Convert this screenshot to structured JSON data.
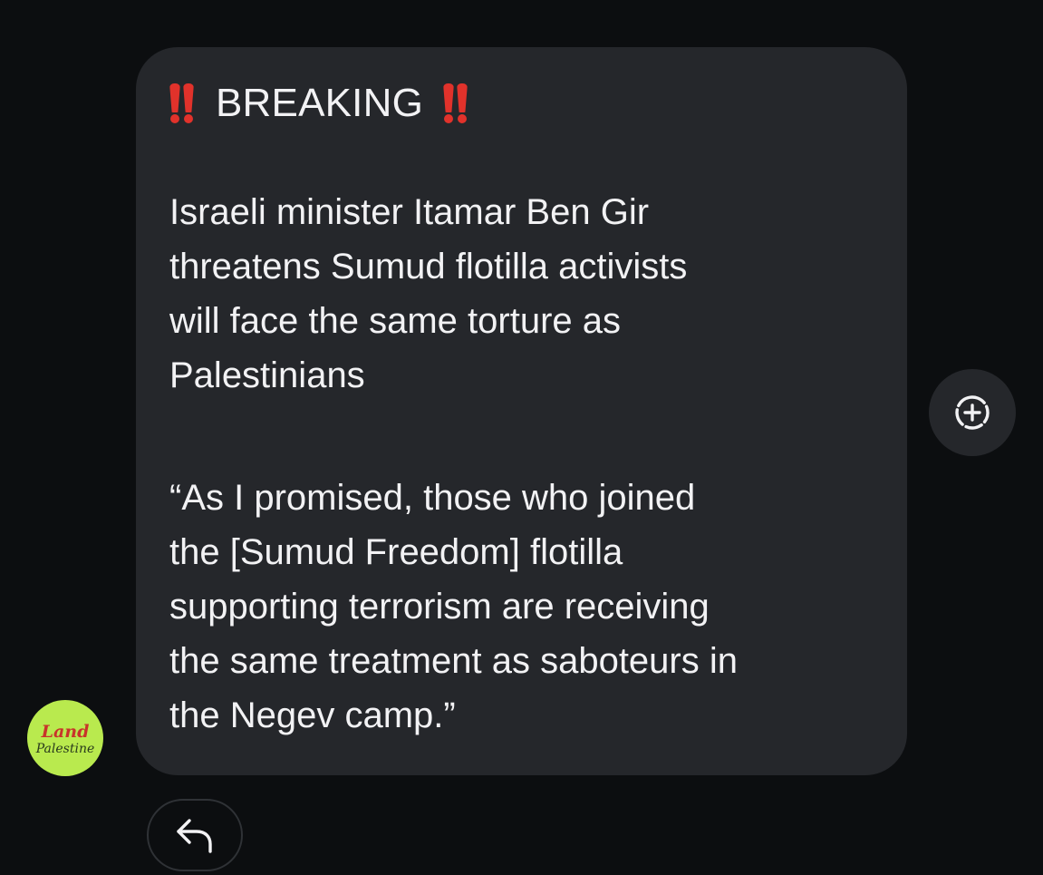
{
  "message": {
    "headline": "BREAKING",
    "headline_marker": "‼️",
    "paragraph_1": "Israeli minister Itamar Ben Gir\nthreatens Sumud flotilla activists\nwill face the same torture as\nPalestinians",
    "paragraph_2": "“As I promised, those who joined\nthe [Sumud Freedom] flotilla\nsupporting terrorism are receiving\nthe same treatment as saboteurs in\nthe Negev camp.”"
  },
  "sender": {
    "avatar_line_1": "Land",
    "avatar_line_2": "Palestine"
  },
  "actions": {
    "add_reaction_icon": "add-reaction-icon",
    "reply_icon": "reply-arrow-icon"
  },
  "colors": {
    "background": "#0c0e10",
    "bubble": "#25272b",
    "text": "#f2f2f4",
    "alert": "#e1322b",
    "avatar": "#b9ea4e"
  }
}
